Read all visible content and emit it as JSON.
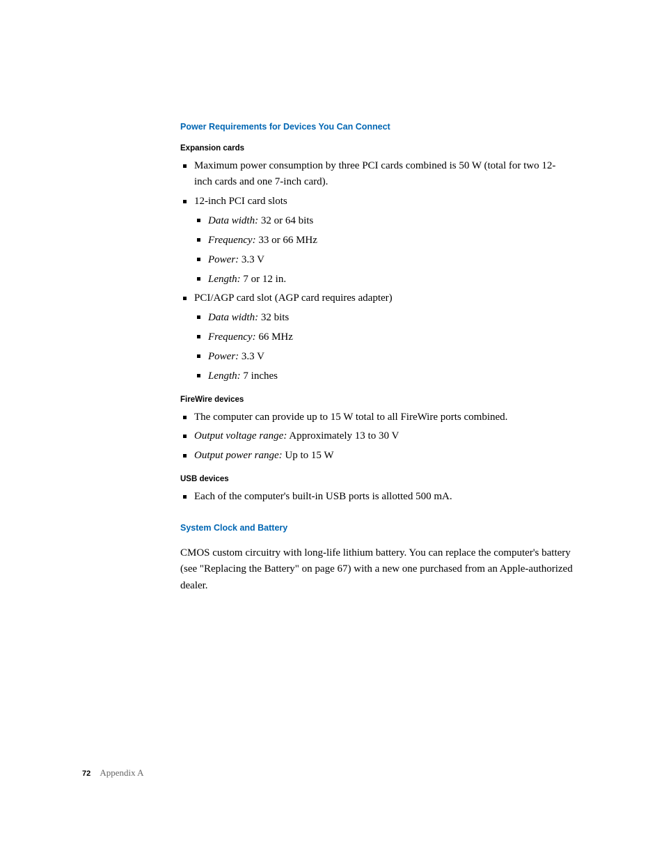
{
  "heading1": "Power Requirements for Devices You Can Connect",
  "expansion": {
    "title": "Expansion cards",
    "items": [
      {
        "text": "Maximum power consumption by three PCI cards combined is 50 W (total for two 12-inch cards and one 7-inch card)."
      },
      {
        "text": "12-inch PCI card slots",
        "sub": [
          {
            "label": "Data width:",
            "value": "  32 or 64 bits"
          },
          {
            "label": "Frequency:",
            "value": "  33 or 66 MHz"
          },
          {
            "label": "Power:",
            "value": "  3.3 V"
          },
          {
            "label": "Length:",
            "value": "  7 or 12 in."
          }
        ]
      },
      {
        "text": "PCI/AGP card slot (AGP card requires adapter)",
        "sub": [
          {
            "label": "Data width:",
            "value": "  32 bits"
          },
          {
            "label": "Frequency:",
            "value": "  66 MHz"
          },
          {
            "label": "Power:",
            "value": "  3.3 V"
          },
          {
            "label": "Length:",
            "value": "  7 inches"
          }
        ]
      }
    ]
  },
  "firewire": {
    "title": "FireWire devices",
    "items": [
      {
        "text": "The computer can provide up to 15 W total to all FireWire ports combined."
      },
      {
        "label": "Output voltage range:",
        "value": "  Approximately 13 to 30 V"
      },
      {
        "label": "Output power range:",
        "value": "  Up to 15 W"
      }
    ]
  },
  "usb": {
    "title": "USB devices",
    "items": [
      {
        "text": "Each of the computer's built-in USB ports is allotted 500 mA."
      }
    ]
  },
  "heading2": "System Clock and Battery",
  "clock_para": "CMOS custom circuitry with long-life lithium battery. You can replace the computer's battery (see \"Replacing the Battery\" on page 67) with a new one purchased from an Apple-authorized dealer.",
  "footer": {
    "page": "72",
    "appendix": "Appendix A"
  }
}
